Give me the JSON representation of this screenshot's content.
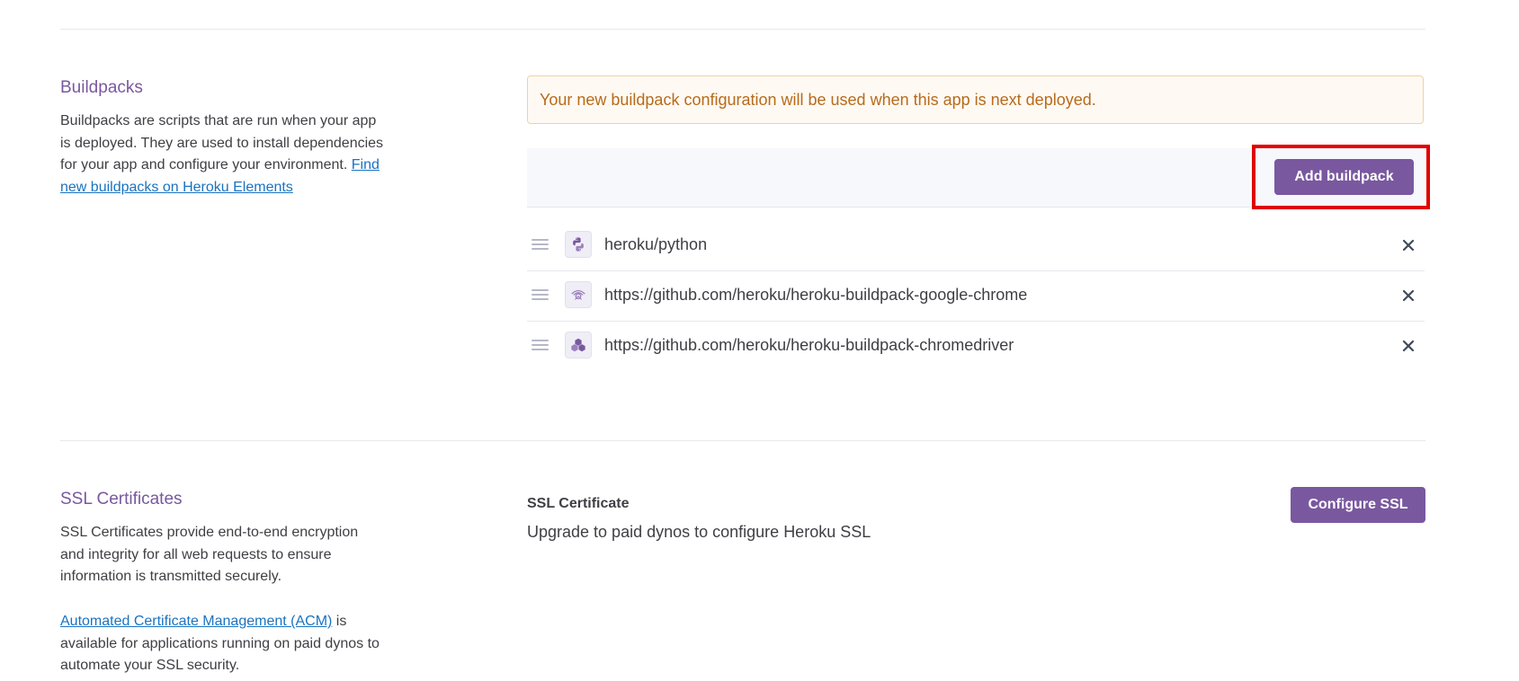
{
  "buildpacks_section": {
    "title": "Buildpacks",
    "description": "Buildpacks are scripts that are run when your app is deployed. They are used to install dependencies for your app and configure your environment.",
    "link_text": "Find new buildpacks on Heroku Elements",
    "notice": "Your new buildpack configuration will be used when this app is next deployed.",
    "add_button_label": "Add buildpack",
    "items": [
      {
        "name": "heroku/python",
        "icon": "python-icon"
      },
      {
        "name": "https://github.com/heroku/heroku-buildpack-google-chrome",
        "icon": "chrome-buildpack-icon"
      },
      {
        "name": "https://github.com/heroku/heroku-buildpack-chromedriver",
        "icon": "chromedriver-buildpack-icon"
      }
    ]
  },
  "ssl_section": {
    "title": "SSL Certificates",
    "description": "SSL Certificates provide end-to-end encryption and integrity for all web requests to ensure information is transmitted securely.",
    "acm_link_text": "Automated Certificate Management (ACM)",
    "acm_text": " is available for applications running on paid dynos to automate your SSL security.",
    "certificate_label": "SSL Certificate",
    "certificate_text": "Upgrade to paid dynos to configure Heroku SSL",
    "configure_button_label": "Configure SSL"
  },
  "colors": {
    "accent": "#79589f",
    "notice_text": "#b86b1a",
    "notice_bg": "#fef9f3",
    "link": "#1a73c1",
    "highlight": "#e00000"
  }
}
